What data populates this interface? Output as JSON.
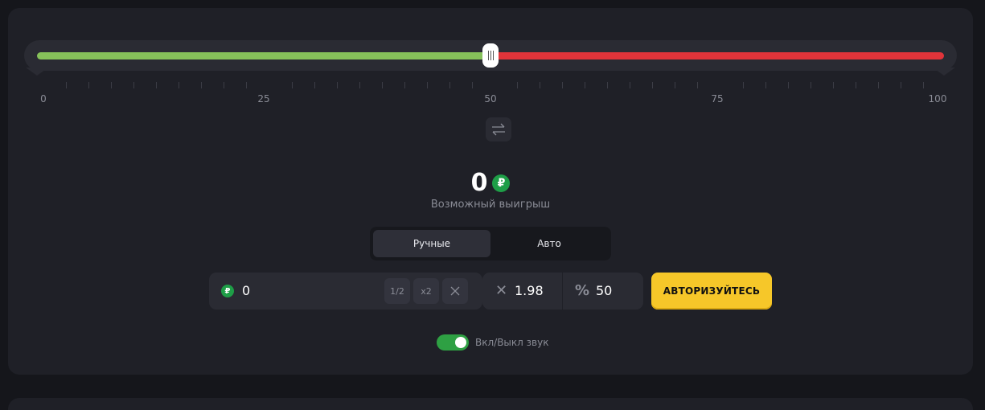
{
  "slider": {
    "value": 50,
    "min": 0,
    "max": 100,
    "tick_labels": [
      "0",
      "25",
      "50",
      "75",
      "100"
    ],
    "win_color": "#86c15a",
    "lose_color": "#e0343a"
  },
  "win": {
    "amount": "0",
    "currency_symbol": "₽",
    "label": "Возможный выигрыш"
  },
  "mode_tabs": [
    {
      "label": "Ручные",
      "active": true
    },
    {
      "label": "Авто",
      "active": false
    }
  ],
  "bet": {
    "currency_symbol": "₽",
    "value": "0",
    "half_label": "1/2",
    "double_label": "x2"
  },
  "coefficient": {
    "multiplier": "1.98",
    "chance": "50"
  },
  "auth_button": "АВТОРИЗУЙТЕСЬ",
  "sound": {
    "label": "Вкл/Выкл звук",
    "enabled": true
  },
  "colors": {
    "accent": "#f6c729",
    "coin": "#1e9e47",
    "toggle_on": "#2ea043"
  }
}
